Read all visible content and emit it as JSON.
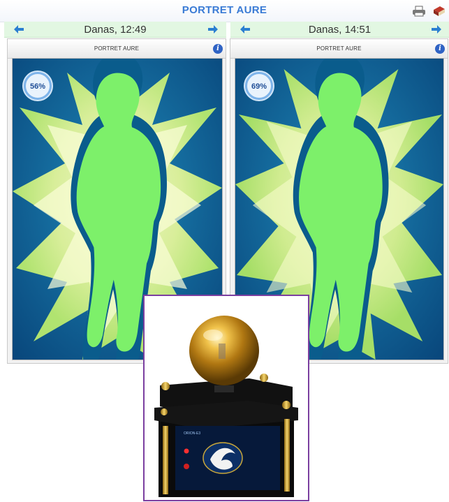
{
  "app": {
    "title": "PORTRET AURE"
  },
  "toolbar": {
    "print_icon": "printer-icon",
    "book_icon": "book-icon"
  },
  "left": {
    "time": "Danas, 12:49",
    "panel_title": "PORTRET AURE",
    "percent_label": "56%",
    "percent_value": 0.56
  },
  "right": {
    "time": "Danas, 14:51",
    "panel_title": "PORTRET AURE",
    "percent_label": "69%",
    "percent_value": 0.69
  },
  "icons": {
    "prev": "arrow-left-icon",
    "next": "arrow-right-icon",
    "info": "info-icon",
    "info_glyph": "i"
  },
  "colors": {
    "title": "#3a7bd5",
    "nav_bg": "#e2f7e2",
    "aura_background": "#0b4f86",
    "aura_glow": "#eaf7a6",
    "body_fill": "#7df06a",
    "body_outline": "#0a5c8c",
    "photo_border": "#7b3fa0"
  },
  "photo": {
    "device_label": "ORION-E3"
  }
}
